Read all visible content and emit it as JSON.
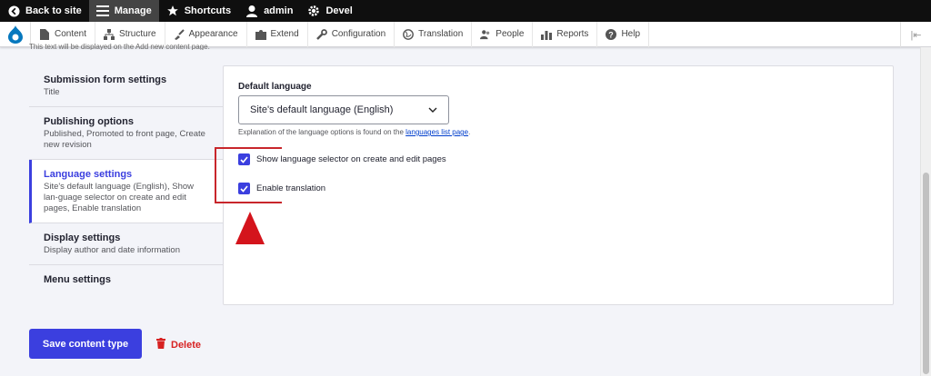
{
  "toolbar": {
    "back_label": "Back to site",
    "manage_label": "Manage",
    "shortcuts_label": "Shortcuts",
    "user_label": "admin",
    "devel_label": "Devel"
  },
  "tray": {
    "items": [
      {
        "label": "Content",
        "icon": "file-icon"
      },
      {
        "label": "Structure",
        "icon": "structure-icon"
      },
      {
        "label": "Appearance",
        "icon": "brush-icon"
      },
      {
        "label": "Extend",
        "icon": "puzzle-icon"
      },
      {
        "label": "Configuration",
        "icon": "wrench-icon"
      },
      {
        "label": "Translation",
        "icon": "globe-icon"
      },
      {
        "label": "People",
        "icon": "people-icon"
      },
      {
        "label": "Reports",
        "icon": "chart-icon"
      },
      {
        "label": "Help",
        "icon": "help-icon"
      }
    ]
  },
  "page": {
    "clipped_text": "This text will be displayed on the Add new content page."
  },
  "vtabs": [
    {
      "title": "Submission form settings",
      "summary": "Title"
    },
    {
      "title": "Publishing options",
      "summary": "Published, Promoted to front page, Create new revision"
    },
    {
      "title": "Language settings",
      "summary": "Site's default language (English), Show lan-guage selector on create and edit pages, Enable translation"
    },
    {
      "title": "Display settings",
      "summary": "Display author and date information"
    },
    {
      "title": "Menu settings",
      "summary": ""
    }
  ],
  "language": {
    "label": "Default language",
    "selected": "Site's default language (English)",
    "description_prefix": "Explanation of the language options is found on the ",
    "description_link": "languages list page",
    "description_suffix": ".",
    "show_selector_label": "Show language selector on create and edit pages",
    "show_selector_checked": true,
    "enable_translation_label": "Enable translation",
    "enable_translation_checked": true
  },
  "actions": {
    "save_label": "Save content type",
    "delete_label": "Delete"
  },
  "colors": {
    "accent": "#3b3fdf",
    "danger": "#d72222",
    "annotation": "#d4141c"
  }
}
